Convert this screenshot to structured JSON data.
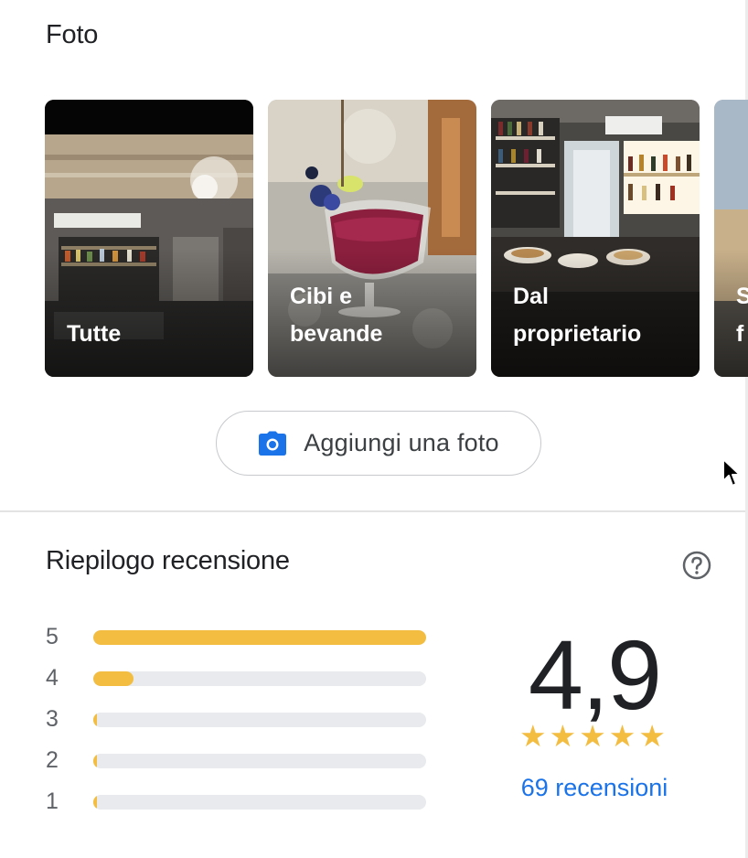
{
  "photos": {
    "title": "Foto",
    "cards": [
      {
        "label": "Tutte"
      },
      {
        "label": "Cibi e\nbevande"
      },
      {
        "label": "Dal\nproprietario"
      },
      {
        "label": "S\nf"
      }
    ],
    "add_button": {
      "label": "Aggiungi una foto",
      "icon": "camera-icon"
    }
  },
  "review_summary": {
    "title": "Riepilogo recensione",
    "help_icon": "help-circle-icon",
    "distribution": [
      {
        "stars": "5",
        "fraction": 1.0
      },
      {
        "stars": "4",
        "fraction": 0.12
      },
      {
        "stars": "3",
        "fraction": 0.01
      },
      {
        "stars": "2",
        "fraction": 0.01
      },
      {
        "stars": "1",
        "fraction": 0.01
      }
    ],
    "average": "4,9",
    "stars": [
      "★",
      "★",
      "★",
      "★",
      "★"
    ],
    "reviews_link": "69 recensioni"
  },
  "colors": {
    "bar_fill": "#f3bd42",
    "bar_track": "#e8eaed",
    "link": "#1a73e8",
    "icon_blue": "#1a73e8"
  }
}
